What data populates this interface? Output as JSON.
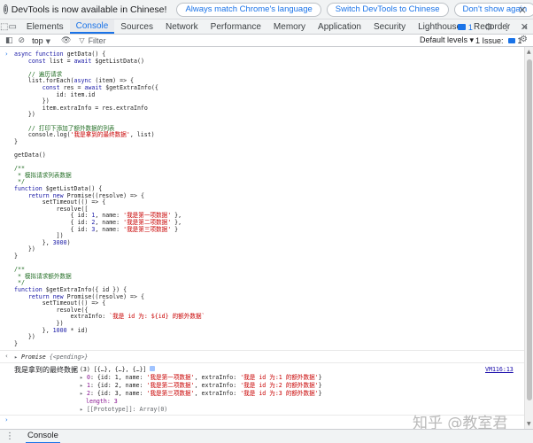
{
  "notice": {
    "message": "DevTools is now available in Chinese!",
    "btn_match": "Always match Chrome's language",
    "btn_switch": "Switch DevTools to Chinese",
    "btn_dont_show": "Don't show again",
    "close": "×"
  },
  "tabs": [
    "Elements",
    "Console",
    "Sources",
    "Network",
    "Performance",
    "Memory",
    "Application",
    "Security",
    "Lighthouse",
    "Recorder"
  ],
  "tab_more": "»",
  "tab_message_count": "1",
  "console_toolbar": {
    "context": "top",
    "filter_placeholder": "Filter",
    "levels": "Default levels ▾",
    "issues": "1 Issue:",
    "issues_count": "1"
  },
  "code_lines": [
    "async function getData() {",
    "    const list = await $getListData()",
    "",
    "    // 遍历请求",
    "    list.forEach(async (item) => {",
    "        const res = await $getExtraInfo({",
    "            id: item.id",
    "        })",
    "        item.extraInfo = res.extraInfo",
    "    })",
    "",
    "    // 打印下添加了额外数据的列表",
    "    console.log('我是拿到的最终数据', list)",
    "}",
    "",
    "getData()",
    "",
    "/**",
    " * 模拟请求列表数据",
    " */",
    "function $getListData() {",
    "    return new Promise((resolve) => {",
    "        setTimeout(() => {",
    "            resolve([",
    "                { id: 1, name: '我是第一项数据' },",
    "                { id: 2, name: '我是第二项数据' },",
    "                { id: 3, name: '我是第三项数据' }",
    "            ])",
    "        }, 3000)",
    "    })",
    "}",
    "",
    "/**",
    " * 模拟请求额外数据",
    " */",
    "function $getExtraInfo({ id }) {",
    "    return new Promise((resolve) => {",
    "        setTimeout(() => {",
    "            resolve({",
    "                extraInfo: `我是 id 为: ${id} 的额外数据`",
    "            })",
    "        }, 1000 * id)",
    "    })",
    "}"
  ],
  "result": {
    "promise_label": "Promise",
    "promise_state": "{<pending>}",
    "log_label": "我是拿到的最终数据",
    "array_summary": "(3) [{…}, {…}, {…}]",
    "vm_link": "VM116:13",
    "items": [
      "0: {id: 1, name: '我是第一项数据', extraInfo: '我是 id 为:1 的额外数据'}",
      "1: {id: 2, name: '我是第二项数据', extraInfo: '我是 id 为:2 的额外数据'}",
      "2: {id: 3, name: '我是第三项数据', extraInfo: '我是 id 为:3 的额外数据'}"
    ],
    "length": "length: 3",
    "prototype": "[[Prototype]]: Array(0)"
  },
  "watermark": "知乎 @教室君",
  "drawer": {
    "tab": "Console"
  },
  "colors": {
    "accent": "#1a73e8",
    "keyword": "#1a1aa6",
    "comment": "#236e25",
    "string": "#c80000"
  }
}
